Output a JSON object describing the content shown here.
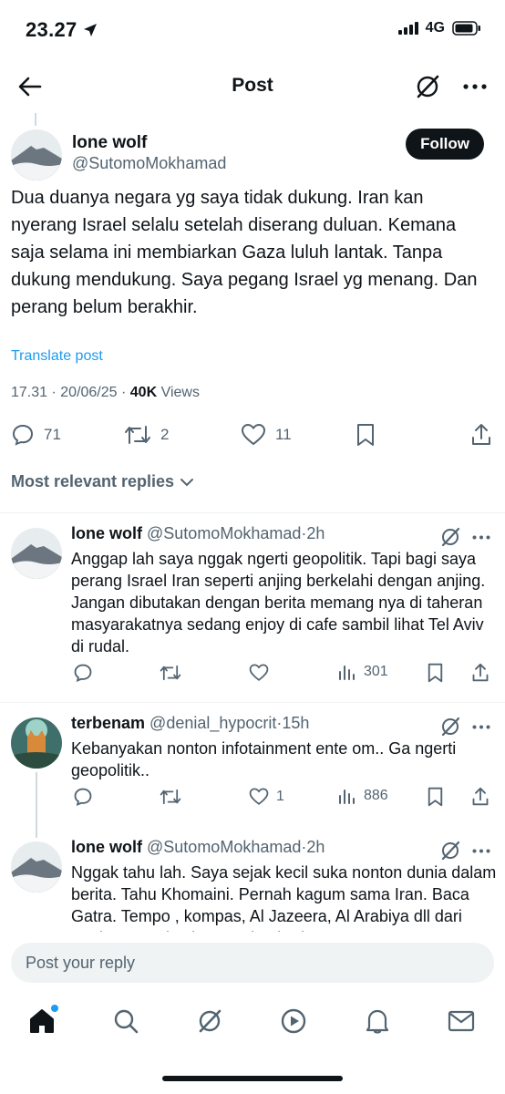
{
  "status_bar": {
    "time": "23.27",
    "network": "4G"
  },
  "header": {
    "title": "Post"
  },
  "post": {
    "author_name": "lone wolf",
    "author_handle": "@SutomoMokhamad",
    "follow_label": "Follow",
    "text": "Dua duanya negara yg saya tidak dukung. Iran kan nyerang Israel selalu  setelah diserang duluan. Kemana saja selama ini membiarkan Gaza luluh lantak. Tanpa dukung mendukung. Saya pegang Israel yg menang. Dan perang belum berakhir.",
    "translate_label": "Translate post",
    "time": "17.31",
    "date": "20/06/25",
    "views_count": "40K",
    "views_label": "Views",
    "replies": "71",
    "reposts": "2",
    "likes": "11"
  },
  "replies_header": "Most relevant replies",
  "replies": [
    {
      "name": "lone wolf",
      "handle": "@SutomoMokhamad",
      "time": "2h",
      "text": "Anggap lah saya nggak ngerti geopolitik. Tapi bagi saya perang Israel Iran seperti anjing berkelahi dengan anjing. Jangan dibutakan dengan berita memang nya di taheran masyarakatnya sedang enjoy di cafe sambil lihat Tel Aviv di rudal.",
      "likes": "",
      "views": "301"
    },
    {
      "name": "terbenam",
      "handle": "@denial_hypocrit",
      "time": "15h",
      "text": "Kebanyakan nonton infotainment ente om.. Ga ngerti geopolitik..",
      "likes": "1",
      "views": "886"
    },
    {
      "name": "lone wolf",
      "handle": "@SutomoMokhamad",
      "time": "2h",
      "text": "Nggak tahu lah. Saya sejak kecil suka nonton dunia dalam berita. Tahu Khomaini. Pernah kagum sama Iran. Baca Gatra. Tempo , kompas, Al Jazeera, Al Arabiya dll dari muda sampai sekarang tiap hari"
    }
  ],
  "compose": {
    "placeholder": "Post your reply"
  },
  "colors": {
    "accent": "#1d9bf0",
    "text": "#0f1419",
    "secondary": "#536471"
  }
}
